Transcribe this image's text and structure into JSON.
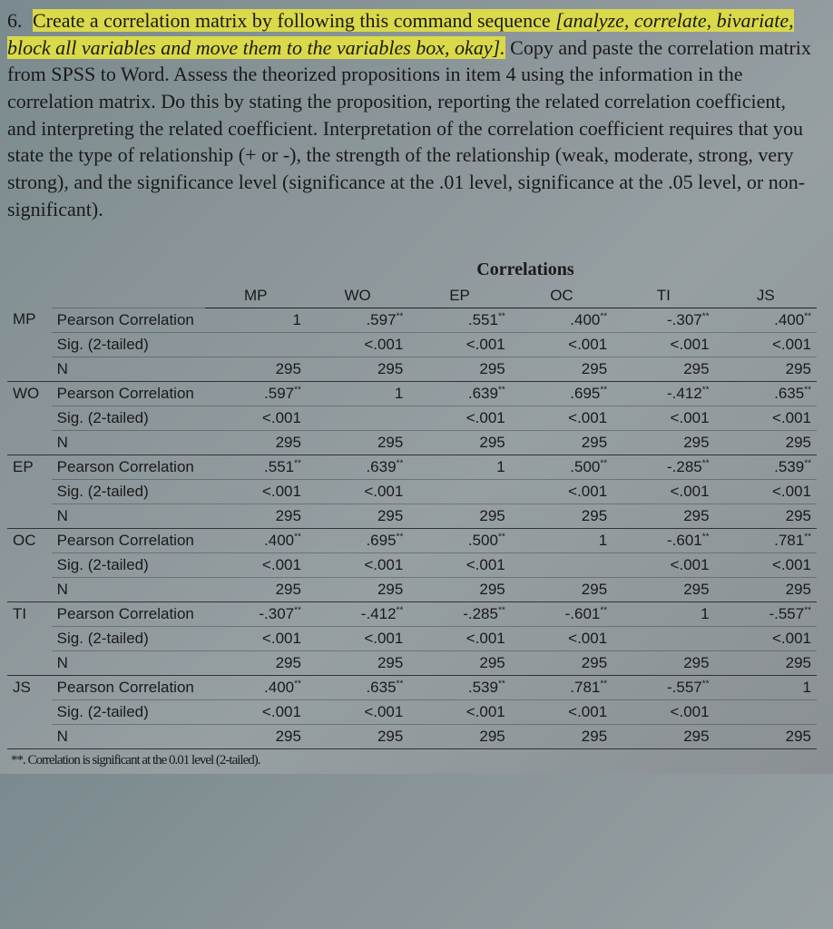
{
  "question": {
    "number": "6.",
    "text_hl1": "Create a correlation matrix by following this command sequence ",
    "cmd_seq": "[analyze, correlate, bivariate, block all variables and move them to the variables box, okay].",
    "text_rest": " Copy and paste the correlation matrix from SPSS to Word. Assess the theorized propositions in item 4 using the information in the correlation matrix. Do this by stating the proposition, reporting the related correlation coefficient, and interpreting the related coefficient. Interpretation of the correlation coefficient requires that you state the type of relationship (+ or -), the strength of the relationship (weak, moderate, strong, very strong), and the significance level (significance at the .01 level, significance at the .05 level, or non-significant)."
  },
  "table": {
    "title": "Correlations",
    "cols": [
      "MP",
      "WO",
      "EP",
      "OC",
      "TI",
      "JS"
    ],
    "stats": [
      "Pearson Correlation",
      "Sig. (2-tailed)",
      "N"
    ],
    "vars": [
      "MP",
      "WO",
      "EP",
      "OC",
      "TI",
      "JS"
    ],
    "cells": {
      "MP": {
        "pc": [
          "1",
          ".597**",
          ".551**",
          ".400**",
          "-.307**",
          ".400**"
        ],
        "sig": [
          "",
          "<.001",
          "<.001",
          "<.001",
          "<.001",
          "<.001"
        ],
        "n": [
          "295",
          "295",
          "295",
          "295",
          "295",
          "295"
        ]
      },
      "WO": {
        "pc": [
          ".597**",
          "1",
          ".639**",
          ".695**",
          "-.412**",
          ".635**"
        ],
        "sig": [
          "<.001",
          "",
          "<.001",
          "<.001",
          "<.001",
          "<.001"
        ],
        "n": [
          "295",
          "295",
          "295",
          "295",
          "295",
          "295"
        ]
      },
      "EP": {
        "pc": [
          ".551**",
          ".639**",
          "1",
          ".500**",
          "-.285**",
          ".539**"
        ],
        "sig": [
          "<.001",
          "<.001",
          "",
          "<.001",
          "<.001",
          "<.001"
        ],
        "n": [
          "295",
          "295",
          "295",
          "295",
          "295",
          "295"
        ]
      },
      "OC": {
        "pc": [
          ".400**",
          ".695**",
          ".500**",
          "1",
          "-.601**",
          ".781**"
        ],
        "sig": [
          "<.001",
          "<.001",
          "<.001",
          "",
          "<.001",
          "<.001"
        ],
        "n": [
          "295",
          "295",
          "295",
          "295",
          "295",
          "295"
        ]
      },
      "TI": {
        "pc": [
          "-.307**",
          "-.412**",
          "-.285**",
          "-.601**",
          "1",
          "-.557**"
        ],
        "sig": [
          "<.001",
          "<.001",
          "<.001",
          "<.001",
          "",
          "<.001"
        ],
        "n": [
          "295",
          "295",
          "295",
          "295",
          "295",
          "295"
        ]
      },
      "JS": {
        "pc": [
          ".400**",
          ".635**",
          ".539**",
          ".781**",
          "-.557**",
          "1"
        ],
        "sig": [
          "<.001",
          "<.001",
          "<.001",
          "<.001",
          "<.001",
          ""
        ],
        "n": [
          "295",
          "295",
          "295",
          "295",
          "295",
          "295"
        ]
      }
    },
    "footnote": "**. Correlation is significant at the 0.01 level (2-tailed)."
  }
}
